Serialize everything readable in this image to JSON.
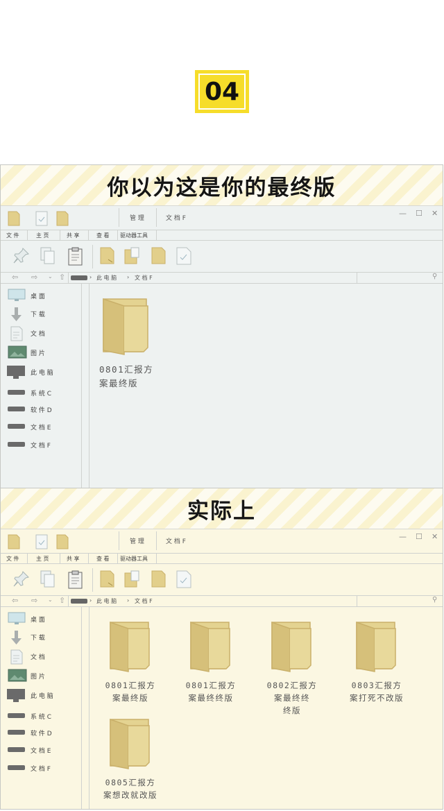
{
  "badge": "04",
  "scene1": {
    "caption": "你以为这是你的最终版",
    "header": {
      "manage": "管 理",
      "location": "文 档 F"
    },
    "ribbon_tabs": [
      "文 件",
      "主 页",
      "共 享",
      "查 看",
      "驱动器工具"
    ],
    "address": [
      "此 电 脑",
      "文 档 F"
    ],
    "sidebar": [
      "桌 面",
      "下 载",
      "文 档",
      "图 片",
      "此 电 脑",
      "系 统 C",
      "软 件 D",
      "文 档 E",
      "文 档 F"
    ],
    "files": [
      "0801汇报方\n案最终版"
    ]
  },
  "scene2": {
    "caption": "实际上",
    "header": {
      "manage": "管 理",
      "location": "文 档 F"
    },
    "ribbon_tabs": [
      "文 件",
      "主 页",
      "共 享",
      "查 看",
      "驱动器工具"
    ],
    "address": [
      "此 电 脑",
      "文 档 F"
    ],
    "sidebar": [
      "桌 面",
      "下 载",
      "文 档",
      "图 片",
      "此 电 脑",
      "系 统 C",
      "软 件 D",
      "文 档 E",
      "文 档 F"
    ],
    "files": [
      "0801汇报方\n案最终版",
      "0801汇报方\n案最终终版",
      "0802汇报方\n案最终终\n终版",
      "0803汇报方\n案打死不改版",
      "0805汇报方\n案想改就改版"
    ]
  },
  "window_controls": [
    "—",
    "☐",
    "✕"
  ],
  "icons": [
    "folder-icon",
    "document-icon",
    "pin-icon",
    "copy-icon",
    "clipboard-icon",
    "monitor-icon",
    "download-icon",
    "image-icon",
    "computer-icon",
    "drive-icon",
    "search-icon",
    "back-arrow-icon",
    "forward-arrow-icon",
    "up-arrow-icon"
  ],
  "colors": {
    "badge": "#f6dd2a",
    "folder": "#e2cf8b",
    "folder_dark": "#c9b06a",
    "panel1_bg": "#eef2f1",
    "panel2_bg": "#fbf7e2"
  }
}
